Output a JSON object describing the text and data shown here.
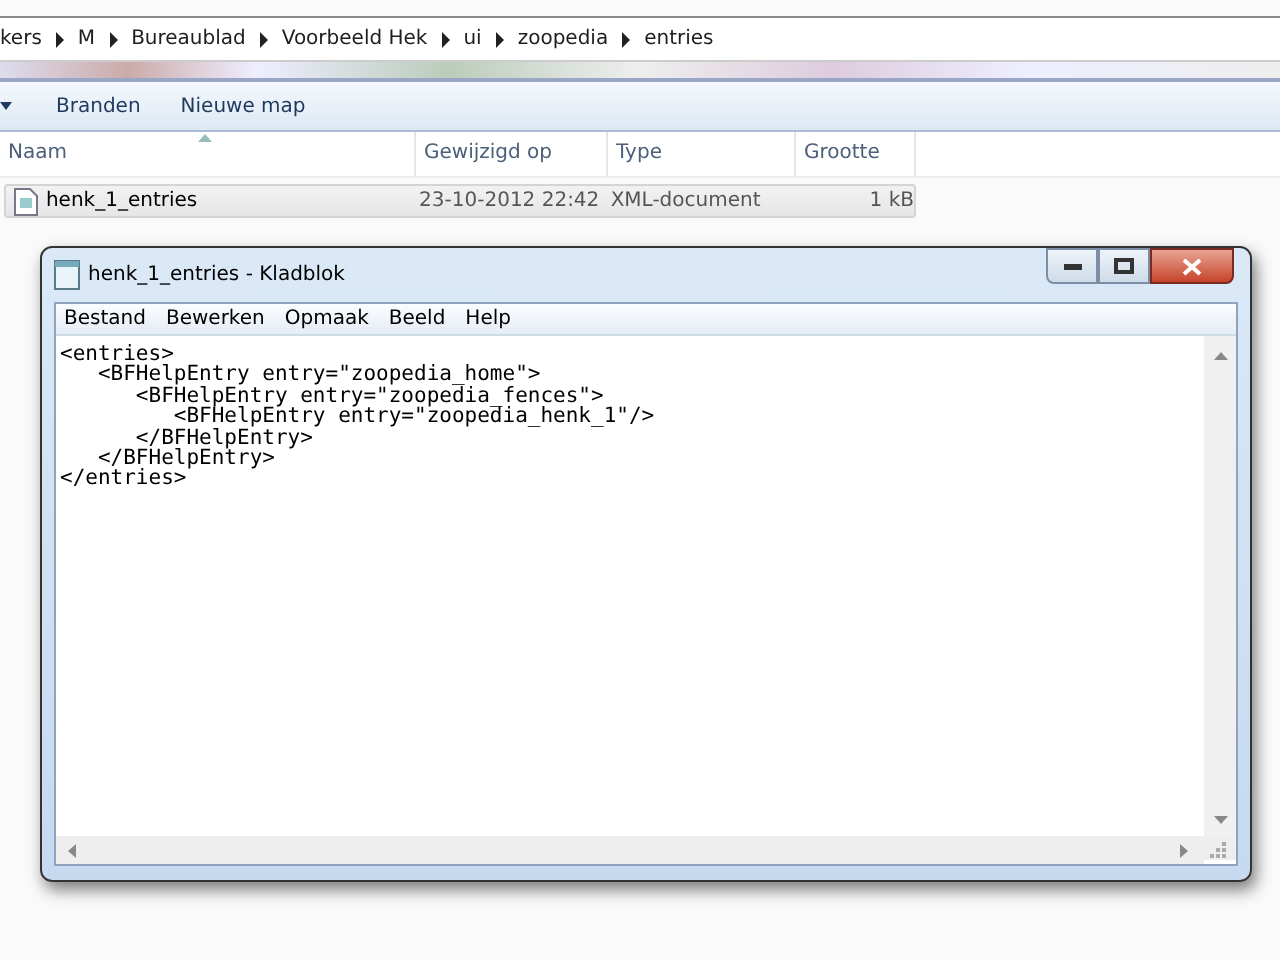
{
  "explorer": {
    "breadcrumb": [
      "kers",
      "M",
      "Bureaublad",
      "Voorbeeld Hek",
      "ui",
      "zoopedia",
      "entries"
    ],
    "toolbar": [
      "Branden",
      "Nieuwe map"
    ],
    "columns": [
      "Naam",
      "Gewijzigd op",
      "Type",
      "Grootte"
    ],
    "rows": [
      {
        "name": "henk_1_entries",
        "modified": "23-10-2012 22:42",
        "type": "XML-document",
        "size": "1 kB",
        "selected": true
      }
    ]
  },
  "notepad": {
    "title": "henk_1_entries - Kladblok",
    "menu": [
      "Bestand",
      "Bewerken",
      "Opmaak",
      "Beeld",
      "Help"
    ],
    "lines": [
      "<entries>",
      "   <BFHelpEntry entry=\"zoopedia_home\">",
      "      <BFHelpEntry entry=\"zoopedia_fences\">",
      "         <BFHelpEntry entry=\"zoopedia_henk_1\"/>",
      "      </BFHelpEntry>",
      "   </BFHelpEntry>",
      "</entries>"
    ]
  }
}
